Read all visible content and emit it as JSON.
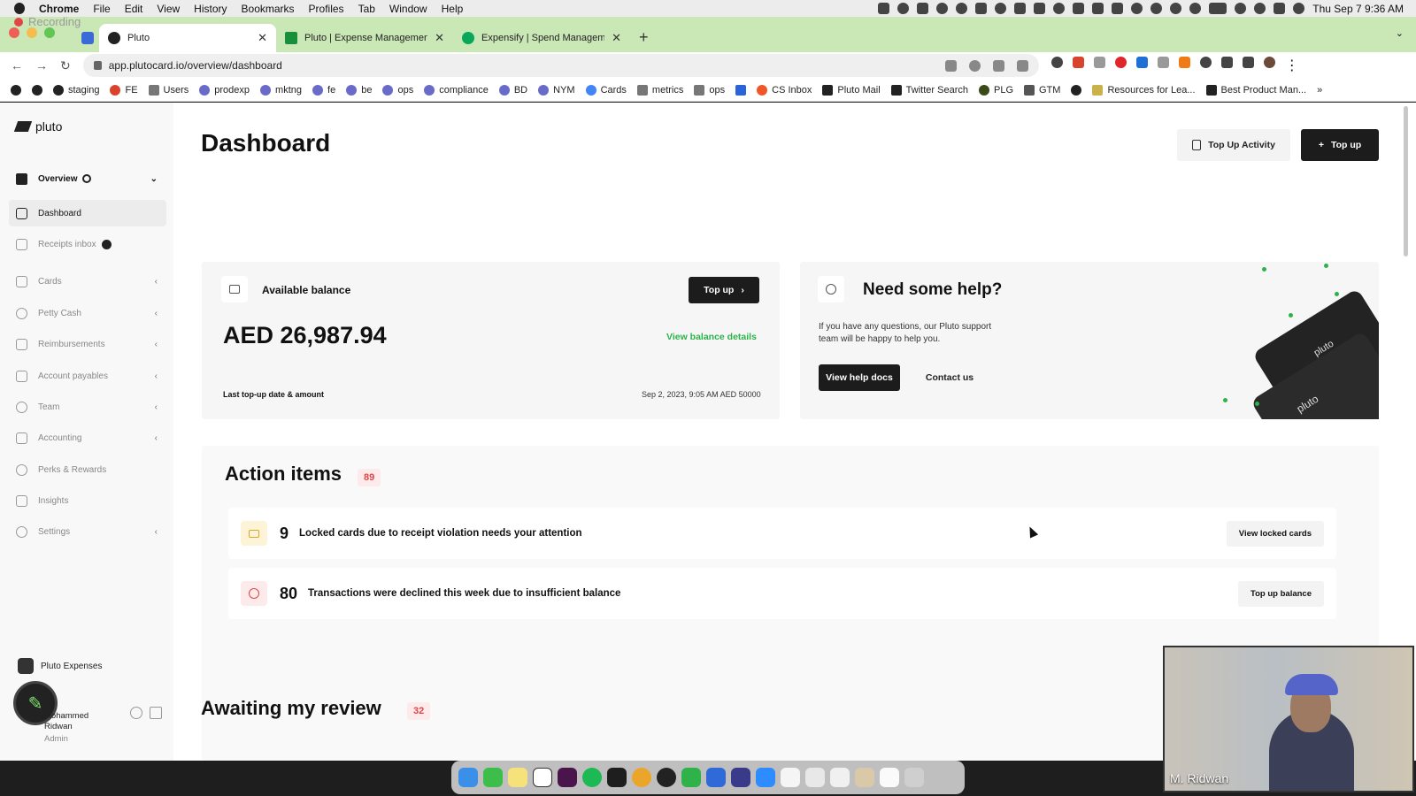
{
  "macos": {
    "app": "Chrome",
    "menus": [
      "File",
      "Edit",
      "View",
      "History",
      "Bookmarks",
      "Profiles",
      "Tab",
      "Window",
      "Help"
    ],
    "clock": "Thu Sep 7  9:36 AM"
  },
  "browser": {
    "recording_label": "Recording",
    "tabs": [
      {
        "title": "Pluto",
        "active": true
      },
      {
        "title": "Pluto | Expense Management b",
        "active": false
      },
      {
        "title": "Expensify | Spend Managemen",
        "active": false
      }
    ],
    "url": "app.plutocard.io/overview/dashboard",
    "bookmarks": [
      "staging",
      "FE",
      "Users",
      "prodexp",
      "mktng",
      "fe",
      "be",
      "ops",
      "compliance",
      "BD",
      "NYM",
      "Cards",
      "metrics",
      "ops",
      "CS Inbox",
      "Pluto Mail",
      "Twitter Search",
      "PLG",
      "GTM",
      "Resources for Lea...",
      "Best Product Man..."
    ]
  },
  "sidebar": {
    "brand": "pluto",
    "overview": "Overview",
    "items": [
      {
        "label": "Dashboard",
        "selected": true
      },
      {
        "label": "Receipts inbox"
      },
      {
        "label": "Cards"
      },
      {
        "label": "Petty Cash"
      },
      {
        "label": "Reimbursements"
      },
      {
        "label": "Account payables"
      },
      {
        "label": "Team"
      },
      {
        "label": "Accounting"
      },
      {
        "label": "Perks & Rewards"
      },
      {
        "label": "Insights"
      },
      {
        "label": "Settings"
      }
    ],
    "org": "Pluto Expenses",
    "user_first": "Mohammed",
    "user_last": "Ridwan",
    "role": "Admin"
  },
  "header": {
    "title": "Dashboard",
    "topup_activity": "Top Up Activity",
    "topup": "Top up"
  },
  "balance": {
    "label": "Available balance",
    "topup_button": "Top up",
    "amount": "AED 26,987.94",
    "details_link": "View balance details",
    "last_label": "Last top-up date & amount",
    "last_value": "Sep 2, 2023, 9:05 AM AED 50000"
  },
  "help": {
    "title": "Need some help?",
    "line1": "If you have any questions, our Pluto support",
    "line2": "team will be happy to help you.",
    "docs_button": "View help docs",
    "contact_button": "Contact us",
    "card_brand": "pluto"
  },
  "actions": {
    "title": "Action items",
    "count": "89",
    "rows": [
      {
        "num": "9",
        "text": "Locked cards due to receipt violation needs your attention",
        "button": "View locked cards"
      },
      {
        "num": "80",
        "text": "Transactions were declined this week due to insufficient balance",
        "button": "Top up balance"
      }
    ]
  },
  "review": {
    "title": "Awaiting my review",
    "count": "32"
  },
  "video": {
    "name": "M. Ridwan"
  },
  "colors": {
    "accent_green": "#2cb24a",
    "dark": "#1c1c1c",
    "badge_red": "#e04646",
    "tab_bar": "#c9e8b6"
  }
}
